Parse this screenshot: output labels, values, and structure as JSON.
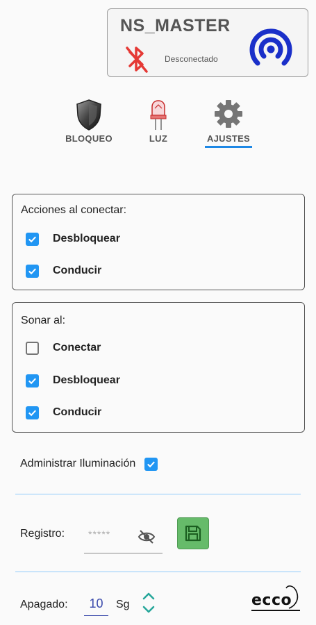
{
  "device": {
    "name": "NS_MASTER",
    "status": "Desconectado",
    "bluetooth_icon": "bluetooth-disabled-icon",
    "broadcast_icon": "broadcast-signal-icon",
    "colors": {
      "bluetooth": "#e53935",
      "broadcast": "#1a2fc9"
    }
  },
  "tabs": [
    {
      "label": "BLOQUEO",
      "icon": "shield-icon",
      "selected": false
    },
    {
      "label": "LUZ",
      "icon": "led-bulb-icon",
      "selected": false
    },
    {
      "label": "AJUSTES",
      "icon": "gear-icon",
      "selected": true
    }
  ],
  "connect_actions": {
    "title": "Acciones al conectar:",
    "items": [
      {
        "label": "Desbloquear",
        "checked": true
      },
      {
        "label": "Conducir",
        "checked": true
      }
    ]
  },
  "sound_on": {
    "title": "Sonar al:",
    "items": [
      {
        "label": "Conectar",
        "checked": false
      },
      {
        "label": "Desbloquear",
        "checked": true
      },
      {
        "label": "Conducir",
        "checked": true
      }
    ]
  },
  "lighting": {
    "label": "Administrar Iluminación",
    "checked": true
  },
  "register": {
    "label": "Registro:",
    "placeholder": "*****",
    "visibility_icon": "eye-off-icon",
    "save_icon": "floppy-disk-icon"
  },
  "shutdown": {
    "label": "Apagado:",
    "value": "10",
    "unit": "Sg"
  },
  "logo": {
    "text": "ecco"
  },
  "colors": {
    "accent": "#2196f3",
    "save_green": "#66bb6a",
    "chevron_green": "#26a69a",
    "value_blue": "#3949ab"
  }
}
